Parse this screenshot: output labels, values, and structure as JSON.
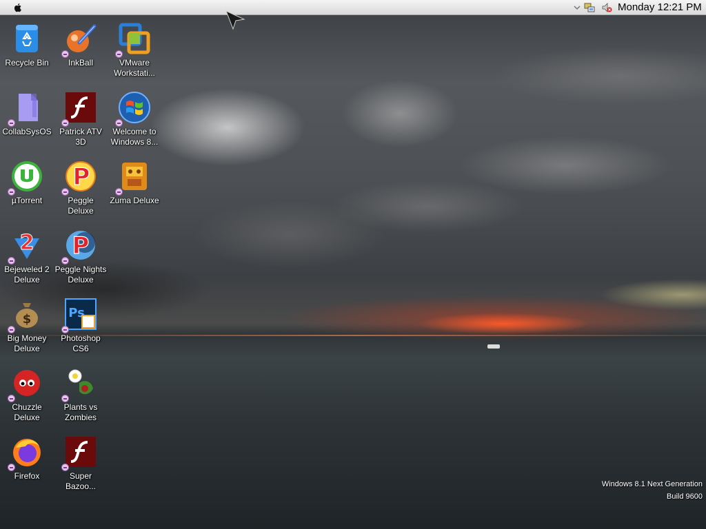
{
  "menubar": {
    "clock": "Monday 12:21 PM",
    "icons": [
      "apple-icon",
      "chevron-down-icon",
      "network-icon",
      "volume-muted-icon"
    ]
  },
  "desktop": {
    "icons": [
      {
        "label": "Recycle Bin",
        "icon": "recycle-bin-icon"
      },
      {
        "label": "InkBall",
        "icon": "inkball-icon"
      },
      {
        "label": "VMware Workstati...",
        "icon": "vmware-icon"
      },
      {
        "label": "CollabSysOS",
        "icon": "folder-icon"
      },
      {
        "label": "Patrick ATV 3D",
        "icon": "flash-icon"
      },
      {
        "label": "Welcome to Windows 8...",
        "icon": "windows-orb-icon"
      },
      {
        "label": "µTorrent",
        "icon": "utorrent-icon"
      },
      {
        "label": "Peggle Deluxe",
        "icon": "peggle-icon"
      },
      {
        "label": "Zuma Deluxe",
        "icon": "zuma-icon"
      },
      {
        "label": "Bejeweled 2 Deluxe",
        "icon": "bejeweled-icon"
      },
      {
        "label": "Peggle Nights Deluxe",
        "icon": "peggle-nights-icon"
      },
      {
        "label": "Big Money Deluxe",
        "icon": "money-bag-icon"
      },
      {
        "label": "Photoshop CS6",
        "icon": "photoshop-icon"
      },
      {
        "label": "Chuzzle Deluxe",
        "icon": "chuzzle-icon"
      },
      {
        "label": "Plants vs Zombies",
        "icon": "plants-vs-zombies-icon"
      },
      {
        "label": "Firefox",
        "icon": "firefox-icon"
      },
      {
        "label": "Super Bazoo...",
        "icon": "flash-icon"
      }
    ]
  },
  "watermark": {
    "line1": "Windows 8.1 Next Generation",
    "line2": "Build 9600"
  }
}
